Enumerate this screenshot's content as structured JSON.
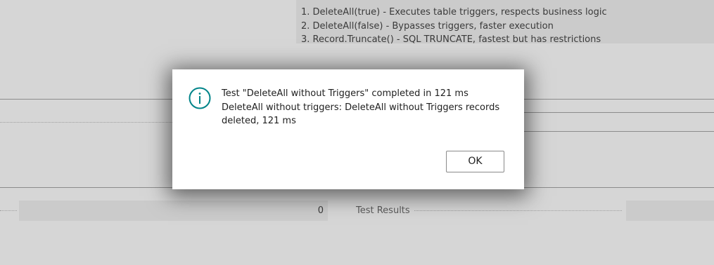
{
  "background": {
    "notes": [
      "1. DeleteAll(true) - Executes table triggers, respects business logic",
      "2. DeleteAll(false) - Bypasses triggers, faster execution",
      "3. Record.Truncate() - SQL TRUNCATE, fastest but has restrictions"
    ],
    "field_value": "0",
    "field_label": "Test Results"
  },
  "dialog": {
    "icon": "info-circle-icon",
    "message_line1": "Test \"DeleteAll without Triggers\" completed in 121 ms",
    "message_line2": "DeleteAll without triggers: DeleteAll without Triggers records deleted, 121 ms",
    "ok_label": "OK"
  },
  "colors": {
    "accent": "#008489",
    "overlay": "#d6d6d6",
    "dialog_bg": "#ffffff"
  }
}
